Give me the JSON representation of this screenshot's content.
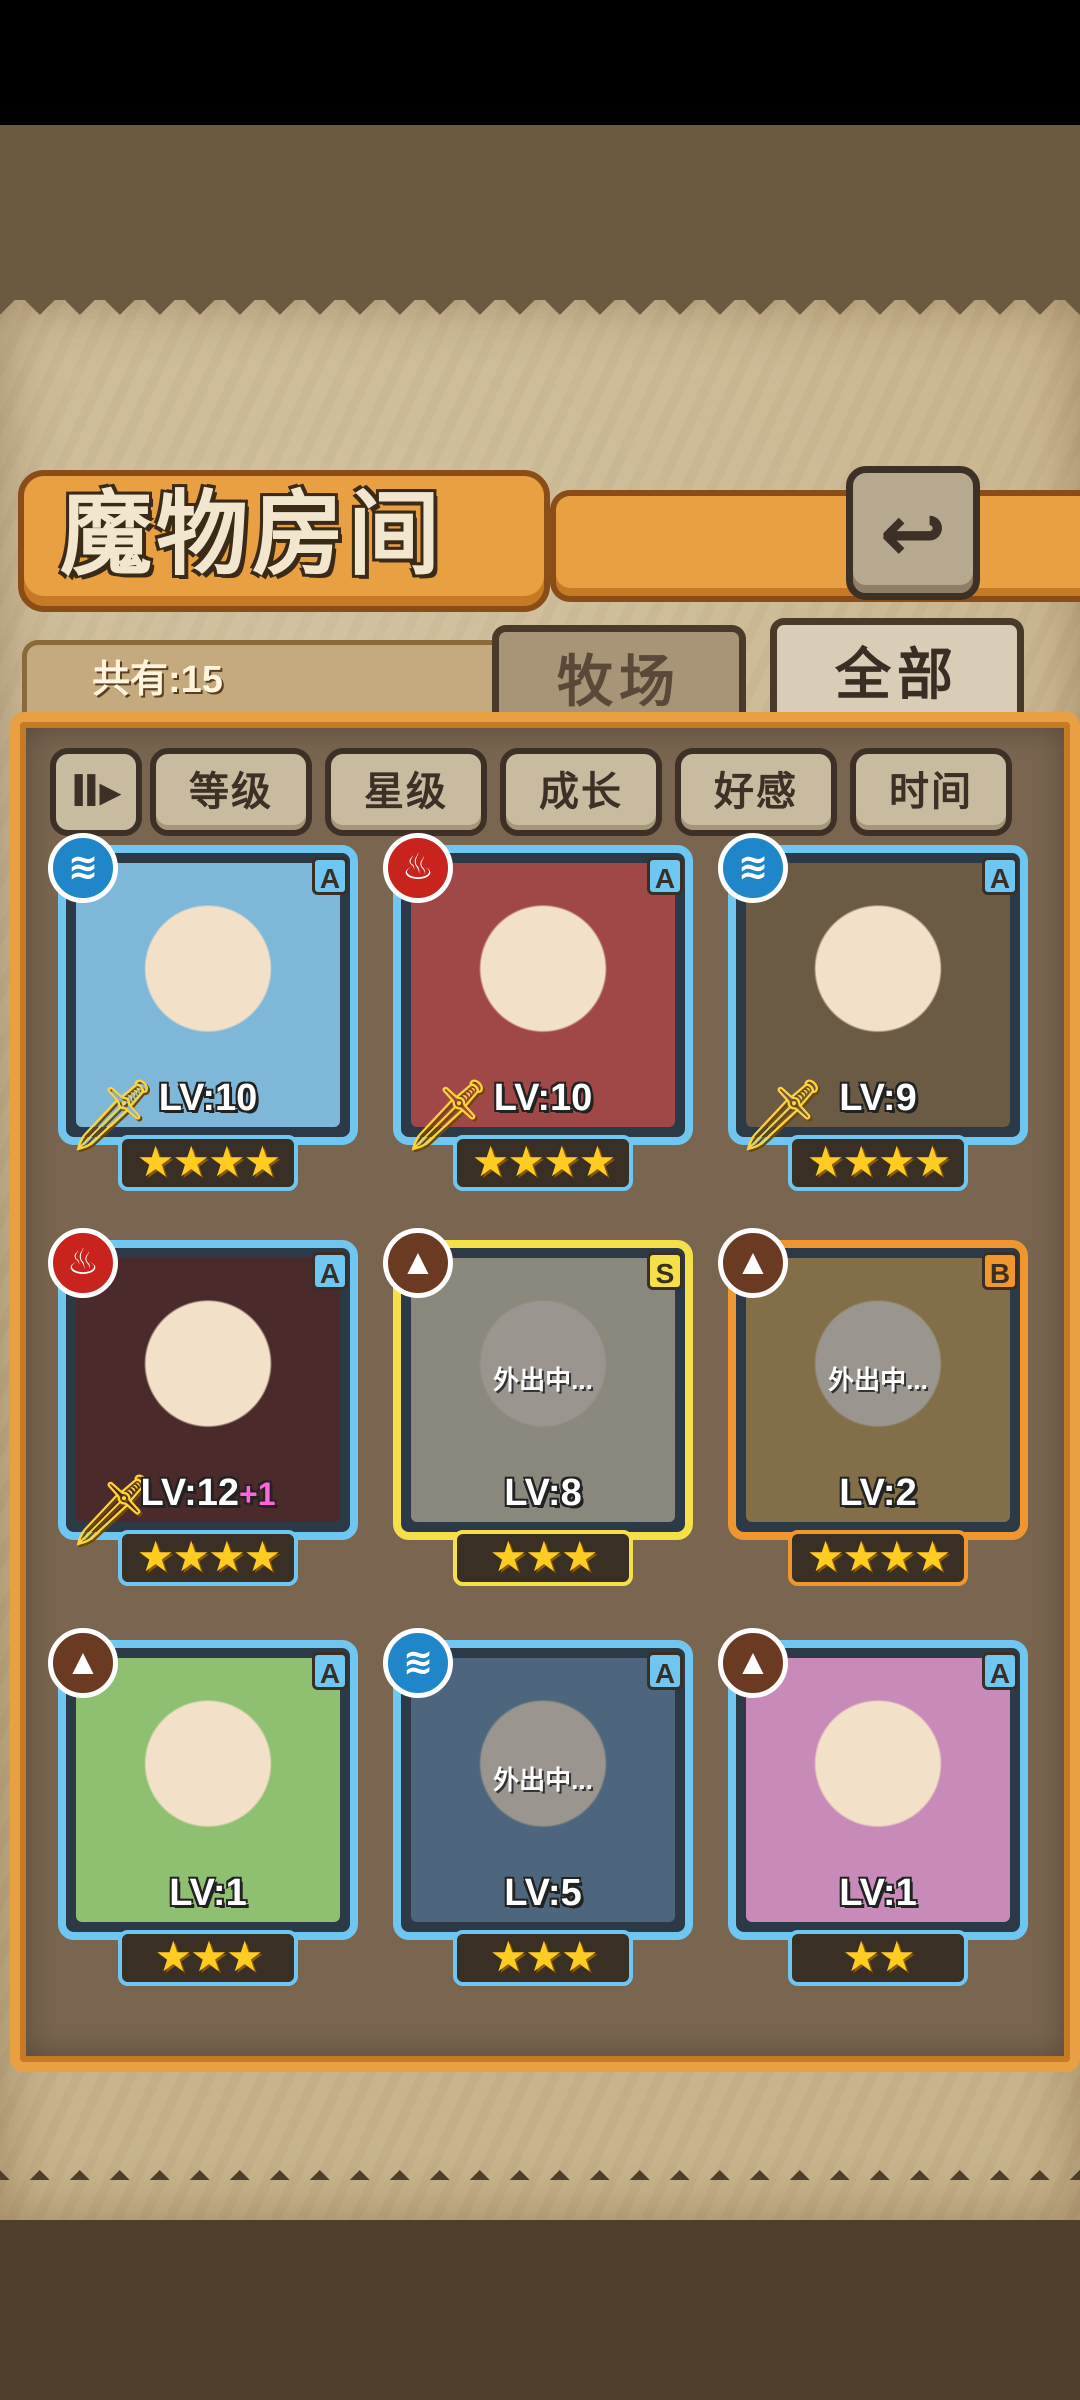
{
  "header": {
    "title": "魔物房间",
    "back_icon": "↩"
  },
  "summary": {
    "count_label": "共有:15"
  },
  "tabs": [
    {
      "label": "牧场"
    },
    {
      "label": "全部"
    }
  ],
  "sort": {
    "toggle_label": "Ⅱ▸",
    "buttons": [
      {
        "label": "等级"
      },
      {
        "label": "星级"
      },
      {
        "label": "成长"
      },
      {
        "label": "好感"
      },
      {
        "label": "时间"
      }
    ]
  },
  "monsters": [
    {
      "level": "LV:10",
      "plus": "",
      "rank": "A",
      "element": "water",
      "element_icon": "≋",
      "stars": 4,
      "stars_text": "★★★★",
      "frame_color": "#6fc6f0",
      "status": "",
      "weapon": true
    },
    {
      "level": "LV:10",
      "plus": "",
      "rank": "A",
      "element": "fire",
      "element_icon": "♨",
      "stars": 4,
      "stars_text": "★★★★",
      "frame_color": "#6fc6f0",
      "status": "",
      "weapon": true
    },
    {
      "level": "LV:9",
      "plus": "",
      "rank": "A",
      "element": "water",
      "element_icon": "≋",
      "stars": 4,
      "stars_text": "★★★★",
      "frame_color": "#6fc6f0",
      "status": "",
      "weapon": true
    },
    {
      "level": "LV:12",
      "plus": "+1",
      "rank": "A",
      "element": "fire",
      "element_icon": "♨",
      "stars": 4,
      "stars_text": "★★★★",
      "frame_color": "#6fc6f0",
      "status": "",
      "weapon": true
    },
    {
      "level": "LV:8",
      "plus": "",
      "rank": "S",
      "element": "earth",
      "element_icon": "▲",
      "stars": 3,
      "stars_text": "★★★",
      "frame_color": "#f5e04a",
      "status": "外出中...",
      "weapon": false
    },
    {
      "level": "LV:2",
      "plus": "",
      "rank": "B",
      "element": "earth",
      "element_icon": "▲",
      "stars": 4,
      "stars_text": "★★★★",
      "frame_color": "#f0962e",
      "status": "外出中...",
      "weapon": false
    },
    {
      "level": "LV:1",
      "plus": "",
      "rank": "A",
      "element": "earth",
      "element_icon": "▲",
      "stars": 3,
      "stars_text": "★★★",
      "frame_color": "#6fc6f0",
      "status": "",
      "weapon": false
    },
    {
      "level": "LV:5",
      "plus": "",
      "rank": "A",
      "element": "water",
      "element_icon": "≋",
      "stars": 3,
      "stars_text": "★★★",
      "frame_color": "#6fc6f0",
      "status": "外出中...",
      "weapon": false
    },
    {
      "level": "LV:1",
      "plus": "",
      "rank": "A",
      "element": "earth",
      "element_icon": "▲",
      "stars": 2,
      "stars_text": "★★",
      "frame_color": "#6fc6f0",
      "status": "",
      "weapon": false
    }
  ],
  "colors": {
    "water": "#1f86c9",
    "fire": "#c8231c",
    "earth": "#6b3a22",
    "accent": "#e8a043"
  }
}
